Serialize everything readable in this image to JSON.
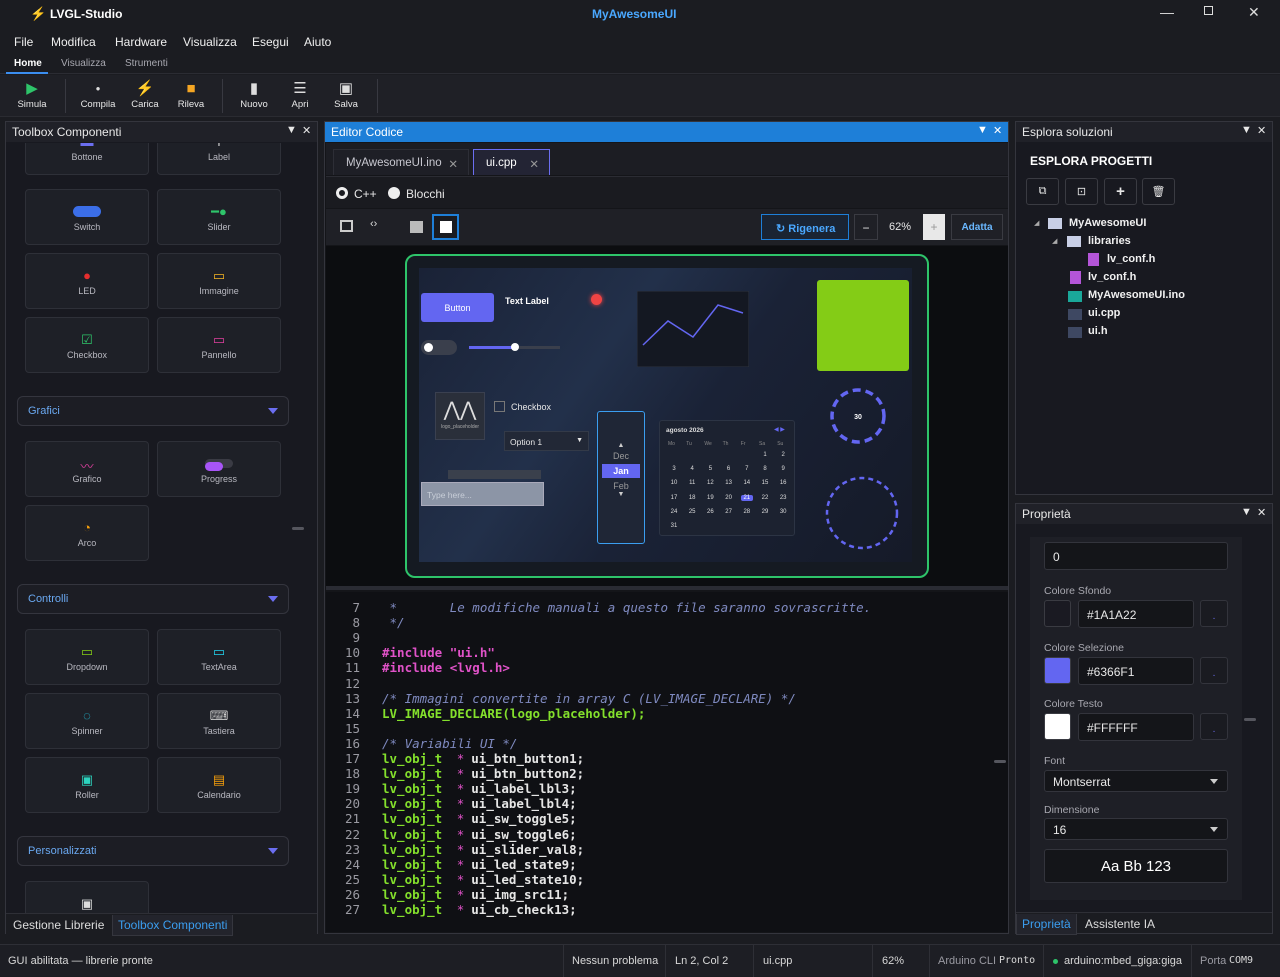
{
  "app": {
    "name": "LVGL-Studio",
    "project": "MyAwesomeUI"
  },
  "menu": [
    "File",
    "Modifica",
    "Hardware",
    "Visualizza",
    "Esegui",
    "Aiuto"
  ],
  "ribbon_tabs": [
    "Home",
    "Visualizza",
    "Strumenti"
  ],
  "toolbar": {
    "simula": "Simula",
    "compila": "Compila",
    "carica": "Carica",
    "rileva": "Rileva",
    "nuovo": "Nuovo",
    "apri": "Apri",
    "salva": "Salva"
  },
  "toolbox": {
    "title": "Toolbox Componenti",
    "top": [
      {
        "label": "Bottone"
      },
      {
        "label": "Label"
      },
      {
        "label": "Switch"
      },
      {
        "label": "Slider"
      },
      {
        "label": "LED"
      },
      {
        "label": "Immagine"
      },
      {
        "label": "Checkbox"
      },
      {
        "label": "Pannello"
      }
    ],
    "cat_grafici": "Grafici",
    "grafici": [
      {
        "label": "Grafico"
      },
      {
        "label": "Progress"
      },
      {
        "label": "Arco"
      }
    ],
    "cat_controlli": "Controlli",
    "controlli": [
      {
        "label": "Dropdown"
      },
      {
        "label": "TextArea"
      },
      {
        "label": "Spinner"
      },
      {
        "label": "Tastiera"
      },
      {
        "label": "Roller"
      },
      {
        "label": "Calendario"
      }
    ],
    "cat_personalizzati": "Personalizzati",
    "tab_libs": "Gestione Librerie",
    "tab_toolbox": "Toolbox Componenti"
  },
  "editor": {
    "title": "Editor Codice",
    "tabs": [
      "MyAwesomeUI.ino",
      "ui.cpp"
    ],
    "mode_cpp": "C++",
    "mode_blocks": "Blocchi",
    "regen": "Rigenera",
    "zoom": "62%",
    "fit": "Adatta",
    "preview": {
      "button": "Button",
      "label": "Text Label",
      "checkbox": "Checkbox",
      "dropdown": "Option 1",
      "textarea_placeholder": "Type here...",
      "logo_caption": "logo_placeholder",
      "arc_value": "30",
      "roller": [
        "Dec",
        "Jan",
        "Feb"
      ],
      "calendar_title": "agosto 2026",
      "calendar_days": [
        "Mo",
        "Tu",
        "We",
        "Th",
        "Fr",
        "Sa",
        "Su"
      ],
      "calendar_dates": [
        "1",
        "2",
        "3",
        "4",
        "5",
        "6",
        "7",
        "8",
        "9",
        "10",
        "11",
        "12",
        "13",
        "14",
        "15",
        "16",
        "17",
        "18",
        "19",
        "20",
        "21",
        "22",
        "23",
        "24",
        "25",
        "26",
        "27",
        "28",
        "29",
        "30",
        "31"
      ],
      "chart_data": {
        "type": "line",
        "values": [
          2,
          5,
          3,
          7,
          6
        ]
      }
    },
    "lines": [
      {
        "n": "7",
        "t": " *       Le modifiche manuali a questo file saranno sovrascritte.",
        "k": "comment"
      },
      {
        "n": "8",
        "t": " */",
        "k": "comment"
      },
      {
        "n": "9",
        "t": "",
        "k": "plain"
      },
      {
        "n": "10",
        "t": "#include \"ui.h\"",
        "k": "include"
      },
      {
        "n": "11",
        "t": "#include <lvgl.h>",
        "k": "include"
      },
      {
        "n": "12",
        "t": "",
        "k": "plain"
      },
      {
        "n": "13",
        "t": "/* Immagini convertite in array C (LV_IMAGE_DECLARE) */",
        "k": "comment"
      },
      {
        "n": "14",
        "t": "LV_IMAGE_DECLARE(logo_placeholder);",
        "k": "macro"
      },
      {
        "n": "15",
        "t": "",
        "k": "plain"
      },
      {
        "n": "16",
        "t": "/* Variabili UI */",
        "k": "comment"
      },
      {
        "n": "17",
        "t": "ui_btn_button1;",
        "k": "decl"
      },
      {
        "n": "18",
        "t": "ui_btn_button2;",
        "k": "decl"
      },
      {
        "n": "19",
        "t": "ui_label_lbl3;",
        "k": "decl"
      },
      {
        "n": "20",
        "t": "ui_label_lbl4;",
        "k": "decl"
      },
      {
        "n": "21",
        "t": "ui_sw_toggle5;",
        "k": "decl"
      },
      {
        "n": "22",
        "t": "ui_sw_toggle6;",
        "k": "decl"
      },
      {
        "n": "23",
        "t": "ui_slider_val8;",
        "k": "decl"
      },
      {
        "n": "24",
        "t": "ui_led_state9;",
        "k": "decl"
      },
      {
        "n": "25",
        "t": "ui_led_state10;",
        "k": "decl"
      },
      {
        "n": "26",
        "t": "ui_img_src11;",
        "k": "decl"
      },
      {
        "n": "27",
        "t": "ui_cb_check13;",
        "k": "decl"
      }
    ],
    "decl_type": "lv_obj_t",
    "decl_star": "*"
  },
  "solution": {
    "title": "Esplora soluzioni",
    "heading": "ESPLORA PROGETTI",
    "tree": [
      "MyAwesomeUI",
      "libraries",
      "lv_conf.h",
      "lv_conf.h",
      "MyAwesomeUI.ino",
      "ui.cpp",
      "ui.h"
    ]
  },
  "properties": {
    "title": "Proprietà",
    "top_value": "0",
    "bg_label": "Colore Sfondo",
    "bg_value": "#1A1A22",
    "sel_label": "Colore Selezione",
    "sel_value": "#6366F1",
    "text_label": "Colore Testo",
    "text_value": "#FFFFFF",
    "font_label": "Font",
    "font_value": "Montserrat",
    "size_label": "Dimensione",
    "size_value": "16",
    "sample": "Aa Bb 123",
    "tab_props": "Proprietà",
    "tab_ai": "Assistente IA"
  },
  "status": {
    "left": "GUI abilitata — librerie pronte",
    "problems": "Nessun problema",
    "pos": "Ln 2, Col 2",
    "file": "ui.cpp",
    "zoom": "62%",
    "cli_label": "Arduino CLI",
    "cli_value": "Pronto",
    "board": "arduino:mbed_giga:giga",
    "port_label": "Porta",
    "port_value": "COM9"
  },
  "colors": {
    "accent": "#6366F1",
    "blue": "#1e7fd8",
    "green": "#2ec46a",
    "lime": "#84cc16"
  }
}
